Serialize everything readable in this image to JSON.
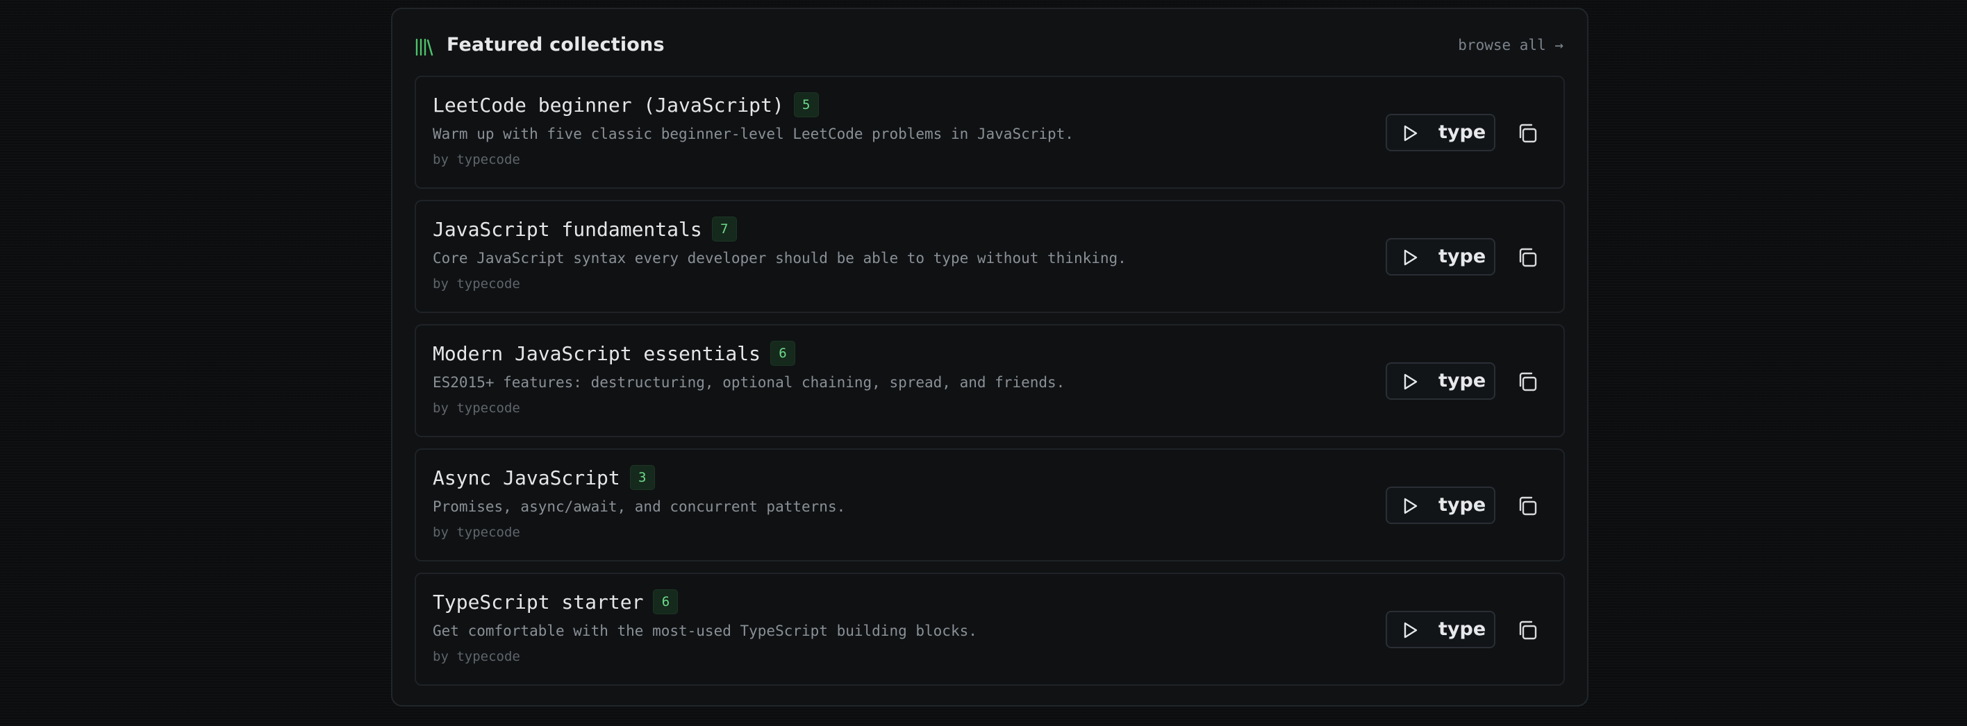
{
  "header": {
    "icon": "library-icon",
    "title": "Featured collections",
    "browse_all": "browse all →"
  },
  "collections": [
    {
      "title": "LeetCode beginner (JavaScript)",
      "count": "5",
      "description": "Warm up with five classic beginner-level LeetCode problems in JavaScript.",
      "author": "by typecode",
      "type_label": "type"
    },
    {
      "title": "JavaScript fundamentals",
      "count": "7",
      "description": "Core JavaScript syntax every developer should be able to type without thinking.",
      "author": "by typecode",
      "type_label": "type"
    },
    {
      "title": "Modern JavaScript essentials",
      "count": "6",
      "description": "ES2015+ features: destructuring, optional chaining, spread, and friends.",
      "author": "by typecode",
      "type_label": "type"
    },
    {
      "title": "Async JavaScript",
      "count": "3",
      "description": "Promises, async/await, and concurrent patterns.",
      "author": "by typecode",
      "type_label": "type"
    },
    {
      "title": "TypeScript starter",
      "count": "6",
      "description": "Get comfortable with the most-used TypeScript building blocks.",
      "author": "by typecode",
      "type_label": "type"
    }
  ],
  "colors": {
    "background": "#0b0d0f",
    "panel": "#101214",
    "accent_green": "#6ddb8a",
    "text_primary": "#e6e8ea",
    "text_muted": "#8a9096"
  }
}
